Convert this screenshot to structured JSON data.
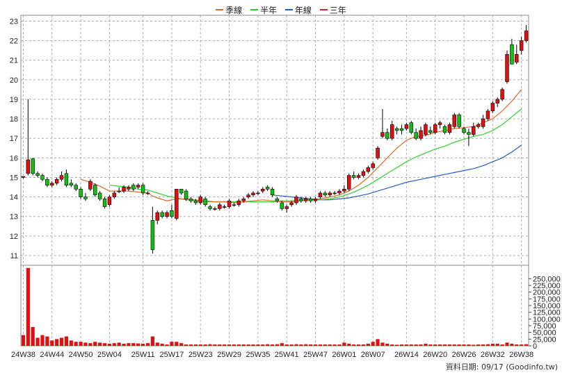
{
  "legend": [
    {
      "name": "季線",
      "color": "#e06a2a"
    },
    {
      "name": "半年",
      "color": "#2bd32b"
    },
    {
      "name": "年線",
      "color": "#2a5cc8"
    },
    {
      "name": "三年",
      "color": "#e0202a"
    }
  ],
  "footer": {
    "text": "資料日期: 09/17   (Goodinfo.tw)"
  },
  "chart_data": {
    "type": "candlestick",
    "price_axis": {
      "ticks": [
        11,
        12,
        13,
        14,
        15,
        16,
        17,
        18,
        19,
        20,
        21,
        22,
        23
      ],
      "ylim": [
        10.5,
        23.3
      ]
    },
    "volume_axis": {
      "ticks": [
        0,
        25000,
        50000,
        75000,
        100000,
        125000,
        150000,
        175000,
        200000,
        225000,
        250000
      ],
      "tick_labels": [
        "0",
        "25,000",
        "50,000",
        "75,000",
        "100,000",
        "125,000",
        "150,000",
        "175,000",
        "200,000",
        "225,000",
        "250,000"
      ],
      "ylim": [
        0,
        300000
      ]
    },
    "x_ticks": [
      {
        "i": 0,
        "label": "24W38"
      },
      {
        "i": 6,
        "label": "24W44"
      },
      {
        "i": 12,
        "label": "24W50"
      },
      {
        "i": 18,
        "label": "25W04"
      },
      {
        "i": 25,
        "label": "25W11"
      },
      {
        "i": 31,
        "label": "25W17"
      },
      {
        "i": 37,
        "label": "25W23"
      },
      {
        "i": 43,
        "label": "25W29"
      },
      {
        "i": 49,
        "label": "25W35"
      },
      {
        "i": 55,
        "label": "25W41"
      },
      {
        "i": 61,
        "label": "25W47"
      },
      {
        "i": 67,
        "label": "26W01"
      },
      {
        "i": 73,
        "label": "26W07"
      },
      {
        "i": 80,
        "label": "26W14"
      },
      {
        "i": 86,
        "label": "26W20"
      },
      {
        "i": 92,
        "label": "26W26"
      },
      {
        "i": 98,
        "label": "26W32"
      },
      {
        "i": 104,
        "label": "26W38"
      }
    ],
    "candles": [
      [
        15.0,
        15.05,
        14.95,
        15.05
      ],
      [
        15.2,
        19.0,
        15.1,
        15.9
      ],
      [
        15.95,
        16.0,
        15.1,
        15.2
      ],
      [
        15.2,
        15.3,
        15.0,
        15.1
      ],
      [
        15.1,
        15.2,
        14.8,
        14.9
      ],
      [
        14.9,
        15.0,
        14.5,
        14.6
      ],
      [
        14.6,
        14.8,
        14.5,
        14.7
      ],
      [
        14.7,
        15.0,
        14.6,
        14.9
      ],
      [
        14.9,
        15.3,
        14.8,
        15.1
      ],
      [
        15.2,
        15.4,
        14.5,
        14.6
      ],
      [
        14.7,
        14.9,
        14.5,
        14.6
      ],
      [
        14.6,
        14.7,
        14.3,
        14.4
      ],
      [
        14.4,
        14.5,
        13.9,
        14.0
      ],
      [
        14.0,
        14.2,
        13.8,
        13.9
      ],
      [
        14.4,
        14.9,
        14.3,
        14.8
      ],
      [
        14.6,
        14.7,
        14.0,
        14.1
      ],
      [
        14.2,
        14.3,
        13.8,
        13.9
      ],
      [
        13.9,
        14.0,
        13.4,
        13.5
      ],
      [
        13.6,
        14.1,
        13.5,
        14.0
      ],
      [
        14.0,
        14.3,
        13.9,
        14.2
      ],
      [
        14.3,
        14.5,
        14.2,
        14.3
      ],
      [
        14.3,
        14.6,
        14.2,
        14.5
      ],
      [
        14.4,
        14.6,
        14.3,
        14.5
      ],
      [
        14.6,
        14.7,
        14.3,
        14.4
      ],
      [
        14.5,
        14.7,
        14.4,
        14.6
      ],
      [
        14.6,
        14.7,
        14.1,
        14.2
      ],
      [
        14.2,
        14.3,
        14.1,
        14.2
      ],
      [
        12.8,
        13.5,
        11.1,
        11.3
      ],
      [
        12.8,
        13.3,
        12.6,
        13.2
      ],
      [
        13.2,
        13.3,
        12.9,
        13.0
      ],
      [
        13.0,
        13.3,
        12.9,
        13.2
      ],
      [
        13.3,
        13.6,
        12.9,
        13.0
      ],
      [
        12.9,
        14.4,
        12.8,
        14.4
      ],
      [
        14.4,
        14.4,
        14.1,
        14.2
      ],
      [
        14.3,
        14.4,
        13.8,
        13.9
      ],
      [
        13.9,
        14.0,
        13.7,
        13.8
      ],
      [
        13.8,
        13.9,
        13.6,
        13.7
      ],
      [
        13.7,
        14.1,
        13.6,
        14.0
      ],
      [
        13.9,
        14.0,
        13.5,
        13.6
      ],
      [
        13.5,
        13.6,
        13.3,
        13.4
      ],
      [
        13.4,
        13.5,
        13.3,
        13.4
      ],
      [
        13.4,
        13.7,
        13.3,
        13.6
      ],
      [
        13.5,
        13.6,
        13.4,
        13.5
      ],
      [
        13.5,
        13.9,
        13.4,
        13.8
      ],
      [
        13.6,
        13.7,
        13.5,
        13.6
      ],
      [
        13.6,
        13.9,
        13.5,
        13.8
      ],
      [
        13.8,
        14.0,
        13.7,
        13.9
      ],
      [
        14.0,
        14.2,
        13.9,
        14.1
      ],
      [
        14.1,
        14.3,
        14.0,
        14.2
      ],
      [
        14.2,
        14.3,
        14.1,
        14.2
      ],
      [
        14.3,
        14.5,
        14.2,
        14.4
      ],
      [
        14.5,
        14.6,
        14.3,
        14.4
      ],
      [
        14.4,
        14.5,
        14.0,
        14.1
      ],
      [
        13.9,
        14.0,
        13.7,
        13.8
      ],
      [
        13.7,
        13.8,
        13.3,
        13.4
      ],
      [
        13.4,
        13.6,
        13.2,
        13.5
      ],
      [
        13.6,
        13.8,
        13.5,
        13.7
      ],
      [
        13.7,
        14.1,
        13.6,
        14.0
      ],
      [
        13.9,
        14.0,
        13.7,
        13.8
      ],
      [
        13.8,
        14.0,
        13.7,
        13.9
      ],
      [
        13.9,
        14.0,
        13.7,
        13.8
      ],
      [
        13.8,
        14.0,
        13.7,
        13.9
      ],
      [
        14.0,
        14.3,
        13.9,
        14.2
      ],
      [
        14.2,
        14.3,
        14.0,
        14.1
      ],
      [
        14.1,
        14.3,
        14.0,
        14.2
      ],
      [
        14.2,
        14.3,
        14.1,
        14.2
      ],
      [
        14.2,
        14.4,
        14.1,
        14.3
      ],
      [
        14.3,
        14.6,
        14.2,
        14.4
      ],
      [
        14.4,
        15.2,
        14.3,
        15.1
      ],
      [
        15.1,
        15.3,
        14.9,
        15.0
      ],
      [
        15.0,
        15.2,
        14.9,
        15.1
      ],
      [
        15.1,
        15.4,
        15.0,
        15.3
      ],
      [
        15.3,
        15.6,
        15.2,
        15.5
      ],
      [
        15.5,
        15.8,
        15.4,
        15.7
      ],
      [
        16.0,
        16.6,
        15.9,
        16.5
      ],
      [
        17.1,
        18.5,
        17.0,
        17.3
      ],
      [
        17.3,
        17.5,
        16.9,
        17.0
      ],
      [
        17.0,
        17.9,
        16.9,
        17.7
      ],
      [
        17.5,
        17.6,
        17.2,
        17.4
      ],
      [
        17.5,
        17.7,
        17.2,
        17.4
      ],
      [
        17.5,
        17.8,
        17.4,
        17.7
      ],
      [
        17.8,
        17.9,
        17.2,
        17.3
      ],
      [
        17.3,
        17.5,
        16.9,
        17.0
      ],
      [
        17.0,
        17.6,
        16.9,
        17.4
      ],
      [
        17.2,
        17.8,
        17.1,
        17.7
      ],
      [
        17.4,
        17.6,
        17.2,
        17.3
      ],
      [
        17.3,
        17.8,
        17.2,
        17.7
      ],
      [
        17.7,
        17.9,
        17.5,
        17.8
      ],
      [
        17.6,
        17.7,
        17.2,
        17.3
      ],
      [
        17.3,
        17.8,
        17.2,
        17.7
      ],
      [
        17.6,
        18.3,
        17.5,
        18.2
      ],
      [
        18.2,
        18.3,
        17.5,
        17.6
      ],
      [
        17.5,
        17.6,
        17.2,
        17.3
      ],
      [
        17.3,
        17.5,
        16.6,
        17.2
      ],
      [
        17.2,
        17.8,
        17.1,
        17.6
      ],
      [
        17.6,
        17.8,
        17.5,
        17.7
      ],
      [
        17.6,
        18.2,
        17.5,
        18.0
      ],
      [
        18.0,
        18.5,
        17.9,
        18.4
      ],
      [
        18.4,
        18.9,
        18.3,
        18.8
      ],
      [
        18.8,
        19.1,
        18.6,
        19.0
      ],
      [
        19.0,
        19.6,
        18.9,
        19.5
      ],
      [
        19.9,
        21.5,
        19.8,
        21.3
      ],
      [
        21.8,
        22.1,
        20.8,
        20.8
      ],
      [
        20.9,
        21.8,
        20.8,
        21.3
      ],
      [
        21.5,
        22.2,
        21.3,
        22.0
      ],
      [
        22.0,
        22.8,
        21.9,
        22.5
      ]
    ],
    "volume": [
      40000,
      290000,
      70000,
      30000,
      40000,
      35000,
      20000,
      25000,
      30000,
      35000,
      20000,
      15000,
      15000,
      12000,
      10000,
      15000,
      12000,
      10000,
      8000,
      10000,
      12000,
      8000,
      10000,
      10000,
      9000,
      8000,
      10000,
      35000,
      12000,
      8000,
      5000,
      15000,
      15000,
      10000,
      5000,
      5000,
      5000,
      5000,
      5000,
      6000,
      5000,
      5000,
      5000,
      5000,
      5000,
      5000,
      5000,
      5000,
      5000,
      5000,
      5000,
      6000,
      5000,
      6000,
      10000,
      5000,
      5000,
      6000,
      5000,
      6000,
      5000,
      5000,
      5000,
      5000,
      5000,
      5000,
      5000,
      12000,
      8000,
      5000,
      5000,
      5000,
      8000,
      15000,
      25000,
      12000,
      8000,
      5000,
      4000,
      5000,
      5000,
      5000,
      5000,
      5000,
      8000,
      5000,
      5000,
      5000,
      5000,
      5000,
      5000,
      5000,
      5000,
      5000,
      4000,
      5000,
      5000,
      6000,
      8000,
      8000,
      5000,
      12000,
      8000,
      5000,
      5000,
      6000
    ],
    "ma_quarter": [
      [
        12,
        14.9
      ],
      [
        14,
        14.75
      ],
      [
        16,
        14.55
      ],
      [
        18,
        14.3
      ],
      [
        20,
        14.3
      ],
      [
        22,
        14.3
      ],
      [
        24,
        14.25
      ],
      [
        26,
        14.2
      ],
      [
        27,
        14.05
      ],
      [
        28,
        13.95
      ],
      [
        30,
        13.8
      ],
      [
        32,
        13.9
      ],
      [
        34,
        13.9
      ],
      [
        36,
        13.85
      ],
      [
        38,
        13.8
      ],
      [
        40,
        13.75
      ],
      [
        42,
        13.75
      ],
      [
        44,
        13.7
      ],
      [
        46,
        13.75
      ],
      [
        48,
        13.8
      ],
      [
        50,
        13.85
      ],
      [
        52,
        13.8
      ],
      [
        54,
        13.75
      ],
      [
        56,
        13.75
      ],
      [
        58,
        13.8
      ],
      [
        60,
        13.85
      ],
      [
        62,
        13.9
      ],
      [
        64,
        14.0
      ],
      [
        66,
        14.1
      ],
      [
        68,
        14.3
      ],
      [
        70,
        14.6
      ],
      [
        72,
        15.0
      ],
      [
        74,
        15.5
      ],
      [
        76,
        16.0
      ],
      [
        78,
        16.5
      ],
      [
        80,
        16.9
      ],
      [
        82,
        17.1
      ],
      [
        84,
        17.15
      ],
      [
        86,
        17.3
      ],
      [
        88,
        17.4
      ],
      [
        90,
        17.5
      ],
      [
        92,
        17.55
      ],
      [
        94,
        17.6
      ],
      [
        96,
        17.8
      ],
      [
        98,
        18.0
      ],
      [
        100,
        18.4
      ],
      [
        102,
        18.9
      ],
      [
        104,
        19.5
      ]
    ],
    "ma_half": [
      [
        18,
        14.6
      ],
      [
        20,
        14.55
      ],
      [
        22,
        14.5
      ],
      [
        24,
        14.4
      ],
      [
        26,
        14.35
      ],
      [
        28,
        14.2
      ],
      [
        30,
        14.05
      ],
      [
        32,
        13.95
      ],
      [
        34,
        13.85
      ],
      [
        36,
        13.8
      ],
      [
        38,
        13.75
      ],
      [
        40,
        13.75
      ],
      [
        42,
        13.75
      ],
      [
        44,
        13.75
      ],
      [
        46,
        13.75
      ],
      [
        48,
        13.75
      ],
      [
        50,
        13.75
      ],
      [
        52,
        13.75
      ],
      [
        54,
        13.8
      ],
      [
        56,
        13.8
      ],
      [
        58,
        13.85
      ],
      [
        60,
        13.85
      ],
      [
        62,
        13.85
      ],
      [
        64,
        13.9
      ],
      [
        66,
        14.0
      ],
      [
        68,
        14.15
      ],
      [
        70,
        14.35
      ],
      [
        72,
        14.6
      ],
      [
        74,
        14.9
      ],
      [
        76,
        15.2
      ],
      [
        78,
        15.5
      ],
      [
        80,
        15.8
      ],
      [
        82,
        16.05
      ],
      [
        84,
        16.25
      ],
      [
        86,
        16.45
      ],
      [
        88,
        16.6
      ],
      [
        90,
        16.8
      ],
      [
        92,
        16.95
      ],
      [
        94,
        17.1
      ],
      [
        96,
        17.2
      ],
      [
        98,
        17.4
      ],
      [
        100,
        17.7
      ],
      [
        102,
        18.1
      ],
      [
        104,
        18.5
      ]
    ],
    "ma_year": [
      [
        52,
        14.1
      ],
      [
        54,
        14.05
      ],
      [
        56,
        14.0
      ],
      [
        58,
        13.95
      ],
      [
        60,
        13.9
      ],
      [
        62,
        13.85
      ],
      [
        64,
        13.85
      ],
      [
        66,
        13.9
      ],
      [
        68,
        13.95
      ],
      [
        70,
        14.05
      ],
      [
        72,
        14.15
      ],
      [
        74,
        14.3
      ],
      [
        76,
        14.45
      ],
      [
        78,
        14.6
      ],
      [
        80,
        14.75
      ],
      [
        82,
        14.85
      ],
      [
        84,
        14.95
      ],
      [
        86,
        15.05
      ],
      [
        88,
        15.15
      ],
      [
        90,
        15.25
      ],
      [
        92,
        15.35
      ],
      [
        94,
        15.45
      ],
      [
        96,
        15.6
      ],
      [
        98,
        15.8
      ],
      [
        100,
        16.0
      ],
      [
        102,
        16.3
      ],
      [
        104,
        16.65
      ]
    ]
  }
}
